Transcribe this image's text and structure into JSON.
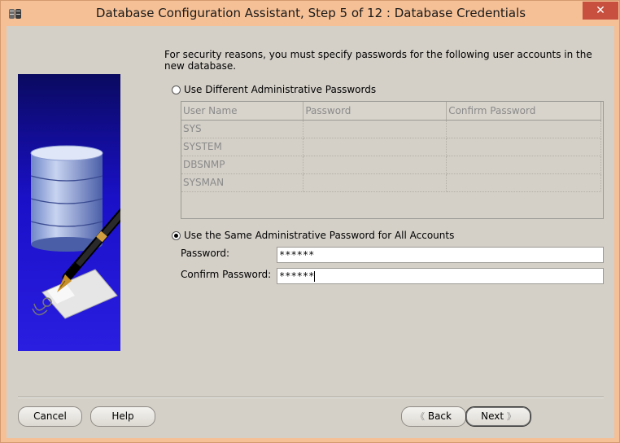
{
  "window": {
    "title": "Database Configuration Assistant, Step 5 of 12 : Database Credentials",
    "close_symbol": "✕"
  },
  "intro_text": "For security reasons, you must specify passwords for the following user accounts in the new database.",
  "different_option": {
    "label": "Use Different Administrative Passwords",
    "selected": false
  },
  "accounts_table": {
    "columns": [
      "User Name",
      "Password",
      "Confirm Password"
    ],
    "rows": [
      {
        "user": "SYS",
        "password": "",
        "confirm": ""
      },
      {
        "user": "SYSTEM",
        "password": "",
        "confirm": ""
      },
      {
        "user": "DBSNMP",
        "password": "",
        "confirm": ""
      },
      {
        "user": "SYSMAN",
        "password": "",
        "confirm": ""
      }
    ]
  },
  "same_option": {
    "label": "Use the Same Administrative Password for All Accounts",
    "selected": true
  },
  "password_field": {
    "label": "Password:",
    "value": "******"
  },
  "confirm_field": {
    "label": "Confirm Password:",
    "value": "******"
  },
  "buttons": {
    "cancel": "Cancel",
    "help": "Help",
    "back": "Back",
    "next": "Next",
    "back_arrow": "《",
    "next_arrow": "》"
  },
  "colors": {
    "titlebar": "#f5c096",
    "panel": "#d4d0c8",
    "close": "#c7503f",
    "illustration_blue": "#1a10c8"
  },
  "icons": [
    "app-icon",
    "database-cylinder-icon",
    "pen-icon",
    "tag-icon",
    "radio-icon",
    "close-icon"
  ]
}
